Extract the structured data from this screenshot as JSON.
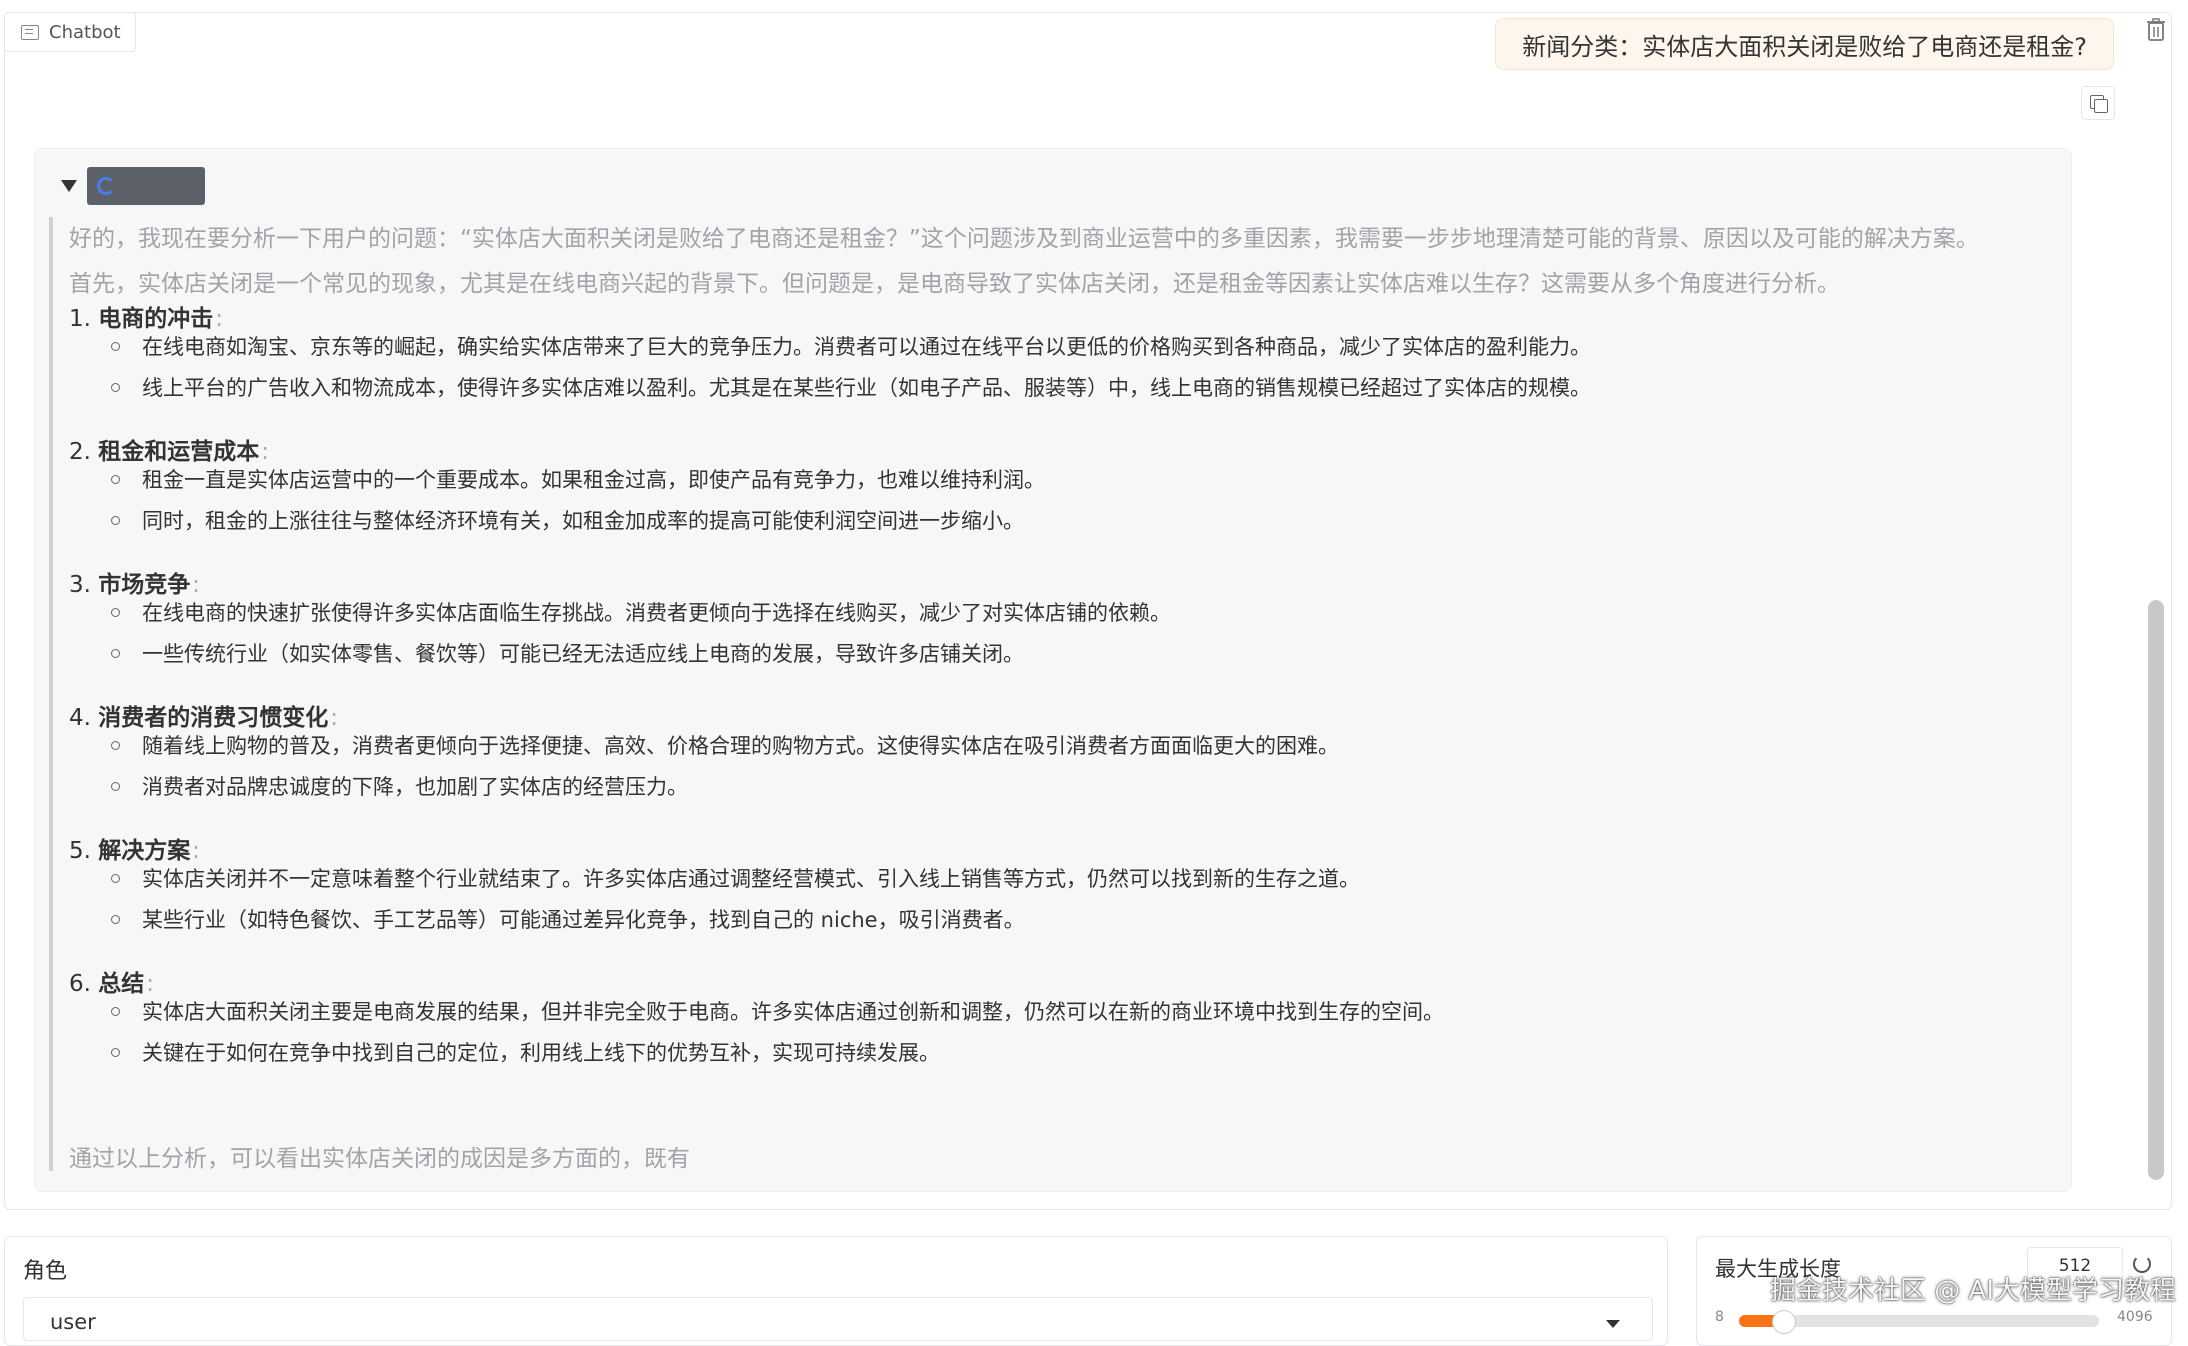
{
  "chatbot": {
    "label": "Chatbot",
    "user_message": "新闻分类：实体店大面积关闭是败给了电商还是租金?",
    "thinking": {
      "paragraphs": [
        "好的，我现在要分析一下用户的问题：“实体店大面积关闭是败给了电商还是租金？”这个问题涉及到商业运营中的多重因素，我需要一步步地理清楚可能的背景、原因以及可能的解决方案。",
        "首先，实体店关闭是一个常见的现象，尤其是在线电商兴起的背景下。但问题是，是电商导致了实体店关闭，还是租金等因素让实体店难以生存？这需要从多个角度进行分析。"
      ],
      "sections": [
        {
          "num": "1.",
          "title": "电商的冲击",
          "colon": ":",
          "bullets": [
            "在线电商如淘宝、京东等的崛起，确实给实体店带来了巨大的竞争压力。消费者可以通过在线平台以更低的价格购买到各种商品，减少了实体店的盈利能力。",
            "线上平台的广告收入和物流成本，使得许多实体店难以盈利。尤其是在某些行业（如电子产品、服装等）中，线上电商的销售规模已经超过了实体店的规模。"
          ]
        },
        {
          "num": "2.",
          "title": "租金和运营成本",
          "colon": ":",
          "bullets": [
            "租金一直是实体店运营中的一个重要成本。如果租金过高，即使产品有竞争力，也难以维持利润。",
            "同时，租金的上涨往往与整体经济环境有关，如租金加成率的提高可能使利润空间进一步缩小。"
          ]
        },
        {
          "num": "3.",
          "title": "市场竞争",
          "colon": ":",
          "bullets": [
            "在线电商的快速扩张使得许多实体店面临生存挑战。消费者更倾向于选择在线购买，减少了对实体店铺的依赖。",
            "一些传统行业（如实体零售、餐饮等）可能已经无法适应线上电商的发展，导致许多店铺关闭。"
          ]
        },
        {
          "num": "4.",
          "title": "消费者的消费习惯变化",
          "colon": ":",
          "bullets": [
            "随着线上购物的普及，消费者更倾向于选择便捷、高效、价格合理的购物方式。这使得实体店在吸引消费者方面面临更大的困难。",
            "消费者对品牌忠诚度的下降，也加剧了实体店的经营压力。"
          ]
        },
        {
          "num": "5.",
          "title": "解决方案",
          "colon": ":",
          "bullets": [
            "实体店关闭并不一定意味着整个行业就结束了。许多实体店通过调整经营模式、引入线上销售等方式，仍然可以找到新的生存之道。",
            "某些行业（如特色餐饮、手工艺品等）可能通过差异化竞争，找到自己的 niche，吸引消费者。"
          ]
        },
        {
          "num": "6.",
          "title": "总结",
          "colon": ":",
          "bullets": [
            "实体店大面积关闭主要是电商发展的结果，但并非完全败于电商。许多实体店通过创新和调整，仍然可以在新的商业环境中找到生存的空间。",
            "关键在于如何在竞争中找到自己的定位，利用线上线下的优势互补，实现可持续发展。"
          ]
        }
      ],
      "trailing": "通过以上分析，可以看出实体店关闭的成因是多方面的，既有"
    }
  },
  "role": {
    "label": "角色",
    "value": "user"
  },
  "max_length": {
    "label": "最大生成长度",
    "value": "512",
    "min": "8",
    "max": "4096",
    "fraction": 0.124,
    "fill_color": "#f97316"
  },
  "watermark": "掘金技术社区 @ AI大模型学习教程",
  "icons": {
    "copy": "copy-icon",
    "trash": "trash-icon",
    "chat": "chat-icon",
    "reset": "reset-icon"
  }
}
